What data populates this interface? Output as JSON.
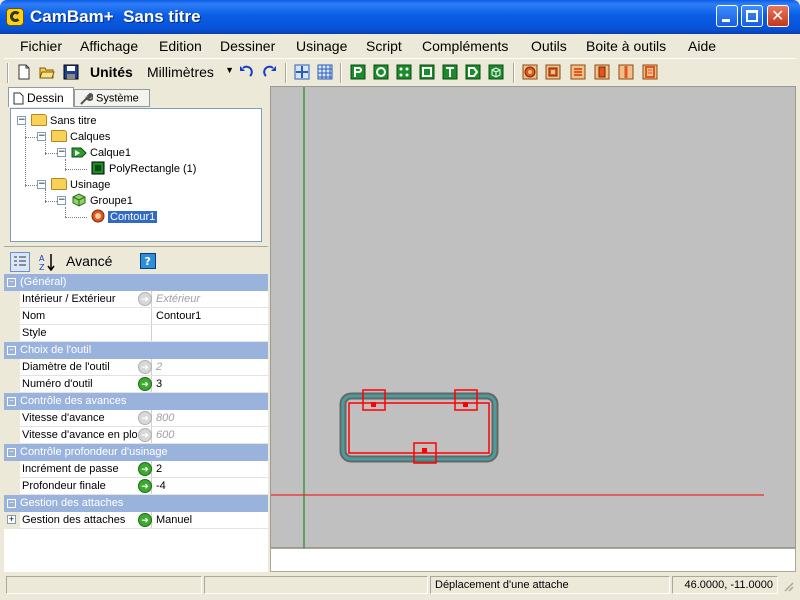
{
  "window": {
    "title": "CamBam+  Sans titre"
  },
  "menu": [
    "Fichier",
    "Affichage",
    "Edition",
    "Dessiner",
    "Usinage",
    "Script",
    "Compléments",
    "Outils",
    "Boite à outils",
    "Aide"
  ],
  "toolbar": {
    "units_label": "Unités",
    "units_value": "Millimètres"
  },
  "tabs": {
    "dessin": "Dessin",
    "systeme": "Système"
  },
  "tree": {
    "root": "Sans titre",
    "calques": "Calques",
    "calque1": "Calque1",
    "polyrect": "PolyRectangle (1)",
    "usinage": "Usinage",
    "groupe1": "Groupe1",
    "contour1": "Contour1"
  },
  "prop_toolbar": {
    "advanced_label": "Avancé"
  },
  "properties": {
    "cat_general": "(Général)",
    "int_ext_name": "Intérieur / Extérieur",
    "int_ext_value": "Extérieur",
    "nom_name": "Nom",
    "nom_value": "Contour1",
    "style_name": "Style",
    "style_value": "",
    "cat_outil": "Choix de l'outil",
    "diam_name": "Diamètre de l'outil",
    "diam_value": "2",
    "num_name": "Numéro d'outil",
    "num_value": "3",
    "cat_avances": "Contrôle des avances",
    "vit_name": "Vitesse d'avance",
    "vit_value": "800",
    "vitplo_name": "Vitesse d'avance en plo",
    "vitplo_value": "600",
    "cat_prof": "Contrôle profondeur d'usinage",
    "incr_name": "Incrément de passe",
    "incr_value": "2",
    "prof_name": "Profondeur finale",
    "prof_value": "-4",
    "cat_attaches": "Gestion des attaches",
    "attaches_name": "Gestion des attaches",
    "attaches_value": "Manuel"
  },
  "status": {
    "left": "",
    "message": "Déplacement d'une attache",
    "coords": "46.0000, -11.0000"
  },
  "colors": {
    "title_blue": "#0a5ee5",
    "category_blue": "#9ab3dd",
    "selection": "#316ac5",
    "canvas": "#c0c0c0",
    "toolpath_red": "#ff0000",
    "axis_green": "#008000"
  }
}
